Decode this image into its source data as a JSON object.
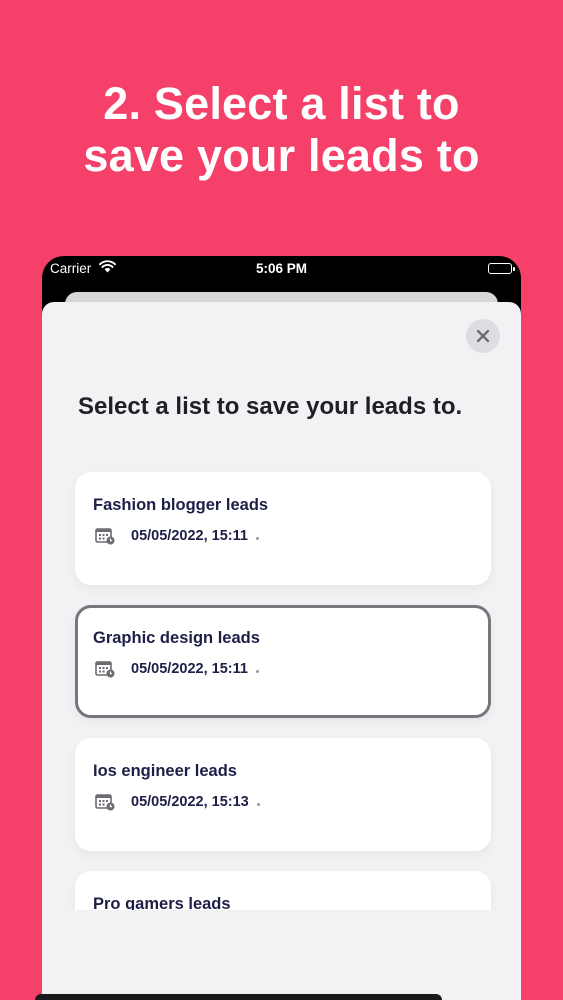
{
  "headline": {
    "line1": "2. Select a list to",
    "line2": "save your leads to"
  },
  "status_bar": {
    "carrier": "Carrier",
    "time": "5:06 PM",
    "icons": [
      "wifi-icon",
      "battery-icon"
    ]
  },
  "sheet": {
    "title": "Select a list to save your leads to.",
    "close_icon": "close-icon"
  },
  "lists": [
    {
      "name": "Fashion blogger leads",
      "date": "05/05/2022, 15:11",
      "selected": false
    },
    {
      "name": "Graphic design leads",
      "date": "05/05/2022, 15:11",
      "selected": true
    },
    {
      "name": "Ios engineer leads",
      "date": "05/05/2022, 15:13",
      "selected": false
    },
    {
      "name": "Pro gamers leads",
      "date": "",
      "selected": false
    }
  ],
  "colors": {
    "background": "#F5406A",
    "sheet": "#F2F2F4",
    "card_text": "#1E1F47",
    "selected_border": "#77767D"
  }
}
